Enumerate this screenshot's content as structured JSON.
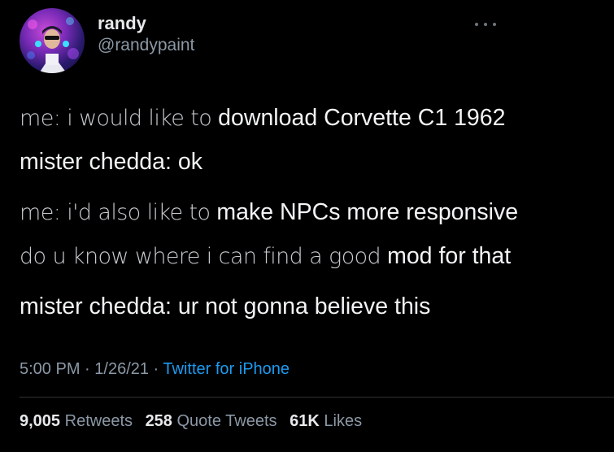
{
  "author": {
    "display_name": "randy",
    "handle": "@randypaint",
    "avatar_icon": "profile-avatar"
  },
  "more_icon": "more-horizontal-icon",
  "tweet_lines": [
    {
      "spans": [
        {
          "text": "me: i would like to ",
          "style": "dim"
        },
        {
          "text": "download Corvette C1 1962",
          "style": "bright"
        }
      ]
    },
    {
      "spans": [
        {
          "text": "mister chedda: ok",
          "style": "bright"
        }
      ]
    },
    {
      "spans": [
        {
          "text": "me: i'd also like to ",
          "style": "dim"
        },
        {
          "text": "make NPCs more responsive",
          "style": "bright"
        }
      ]
    },
    {
      "spans": [
        {
          "text": "do u know where i can find a good ",
          "style": "dim"
        },
        {
          "text": "mod for that",
          "style": "bright"
        }
      ]
    },
    {
      "spans": [
        {
          "text": "mister chedda: ur not gonna believe this",
          "style": "bright"
        }
      ]
    }
  ],
  "meta": {
    "time": "5:00 PM",
    "separator": " · ",
    "date": "1/26/21",
    "source": "Twitter for iPhone"
  },
  "stats": {
    "retweets_count": "9,005",
    "retweets_label": "Retweets",
    "quotes_count": "258",
    "quotes_label": "Quote Tweets",
    "likes_count": "61K",
    "likes_label": "Likes"
  },
  "colors": {
    "background": "#000000",
    "primary_text": "#e7e9ea",
    "secondary_text": "#8b98a5",
    "link": "#1d9bf0"
  }
}
